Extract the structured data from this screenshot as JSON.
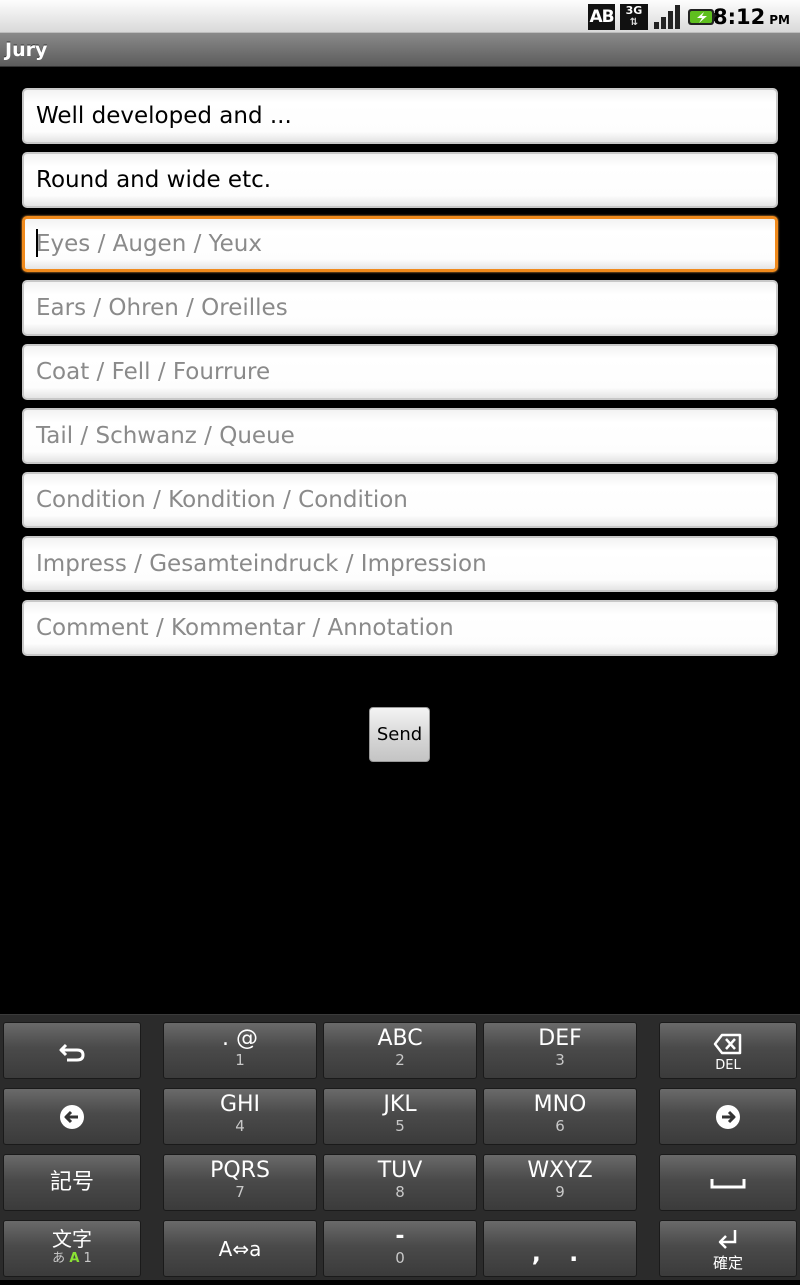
{
  "status_bar": {
    "ab_label": "AB",
    "network_label": "3G",
    "network_arrows": "⇅",
    "time": "8:12",
    "ampm": "PM",
    "icons": [
      "ab-indicator-icon",
      "3g-icon",
      "signal-icon",
      "battery-charging-icon"
    ]
  },
  "app": {
    "title": "Jury"
  },
  "fields": [
    {
      "value": "Well developed and ...",
      "placeholder": ""
    },
    {
      "value": "Round and wide etc.",
      "placeholder": ""
    },
    {
      "value": "",
      "placeholder": "Eyes / Augen / Yeux",
      "focused": true
    },
    {
      "value": "",
      "placeholder": "Ears / Ohren / Oreilles"
    },
    {
      "value": "",
      "placeholder": "Coat / Fell / Fourrure"
    },
    {
      "value": "",
      "placeholder": "Tail / Schwanz / Queue"
    },
    {
      "value": "",
      "placeholder": "Condition / Kondition / Condition"
    },
    {
      "value": "",
      "placeholder": "Impress / Gesamteindruck / Impression"
    },
    {
      "value": "",
      "placeholder": "Comment / Kommentar / Annotation"
    }
  ],
  "send_label": "Send",
  "keyboard": {
    "k1": {
      "main": ". @",
      "sub": "1"
    },
    "k2": {
      "main": "ABC",
      "sub": "2"
    },
    "k3": {
      "main": "DEF",
      "sub": "3"
    },
    "k4": {
      "main": "GHI",
      "sub": "4"
    },
    "k5": {
      "main": "JKL",
      "sub": "5"
    },
    "k6": {
      "main": "MNO",
      "sub": "6"
    },
    "k7": {
      "main": "PQRS",
      "sub": "7"
    },
    "k8": {
      "main": "TUV",
      "sub": "8"
    },
    "k9": {
      "main": "WXYZ",
      "sub": "9"
    },
    "k0": {
      "main": "-",
      "sub": "0"
    },
    "punct": ", .",
    "del_label": "DEL",
    "symbols_label": "記号",
    "mode_label": "文字",
    "mode_sub_hira": "あ",
    "mode_sub_alpha": "A",
    "mode_sub_num": "1",
    "case_label": "A⇔a",
    "confirm_label": "確定",
    "colors": {
      "key_bg": "#4a4a4a",
      "keyboard_bg": "#2b2b2b",
      "mode_active": "#8ae234"
    }
  },
  "colors": {
    "focus_border": "#f08a1c",
    "placeholder": "#8a8a8a",
    "background": "#000000"
  }
}
